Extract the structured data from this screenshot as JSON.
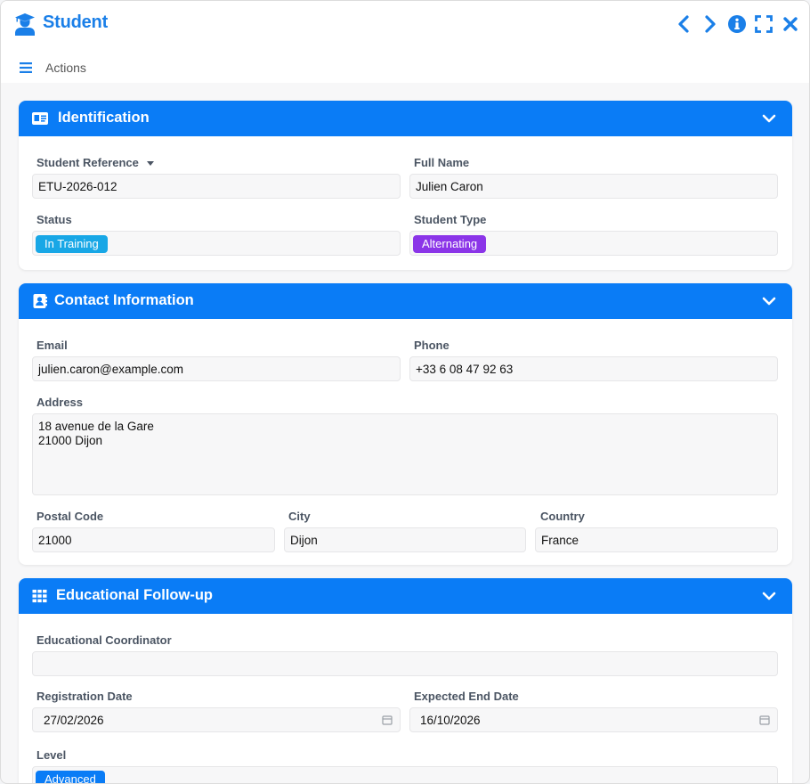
{
  "window": {
    "title": "Student"
  },
  "toolbar": {
    "actions_label": "Actions"
  },
  "identification": {
    "title": "Identification",
    "student_reference": {
      "label": "Student Reference",
      "value": "ETU-2026-012"
    },
    "full_name": {
      "label": "Full Name",
      "value": "Julien Caron"
    },
    "status": {
      "label": "Status",
      "value": "In Training",
      "color": "#18a7e6"
    },
    "student_type": {
      "label": "Student Type",
      "value": "Alternating",
      "color": "#8b35e8"
    }
  },
  "contact": {
    "title": "Contact Information",
    "email": {
      "label": "Email",
      "value": "julien.caron@example.com"
    },
    "phone": {
      "label": "Phone",
      "value": "+33 6 08 47 92 63"
    },
    "address": {
      "label": "Address",
      "line1": "18 avenue de la Gare",
      "line2": "21000 Dijon"
    },
    "postal_code": {
      "label": "Postal Code",
      "value": "21000"
    },
    "city": {
      "label": "City",
      "value": "Dijon"
    },
    "country": {
      "label": "Country",
      "value": "France"
    }
  },
  "education": {
    "title": "Educational Follow-up",
    "coordinator": {
      "label": "Educational Coordinator",
      "value": ""
    },
    "registration_date": {
      "label": "Registration Date",
      "value": "27/02/2026"
    },
    "expected_end_date": {
      "label": "Expected End Date",
      "value": "16/10/2026"
    },
    "level": {
      "label": "Level",
      "value": "Advanced",
      "color": "#0a7cf6"
    }
  },
  "colors": {
    "accent": "#0a7cf6",
    "title": "#1a7fe8"
  }
}
